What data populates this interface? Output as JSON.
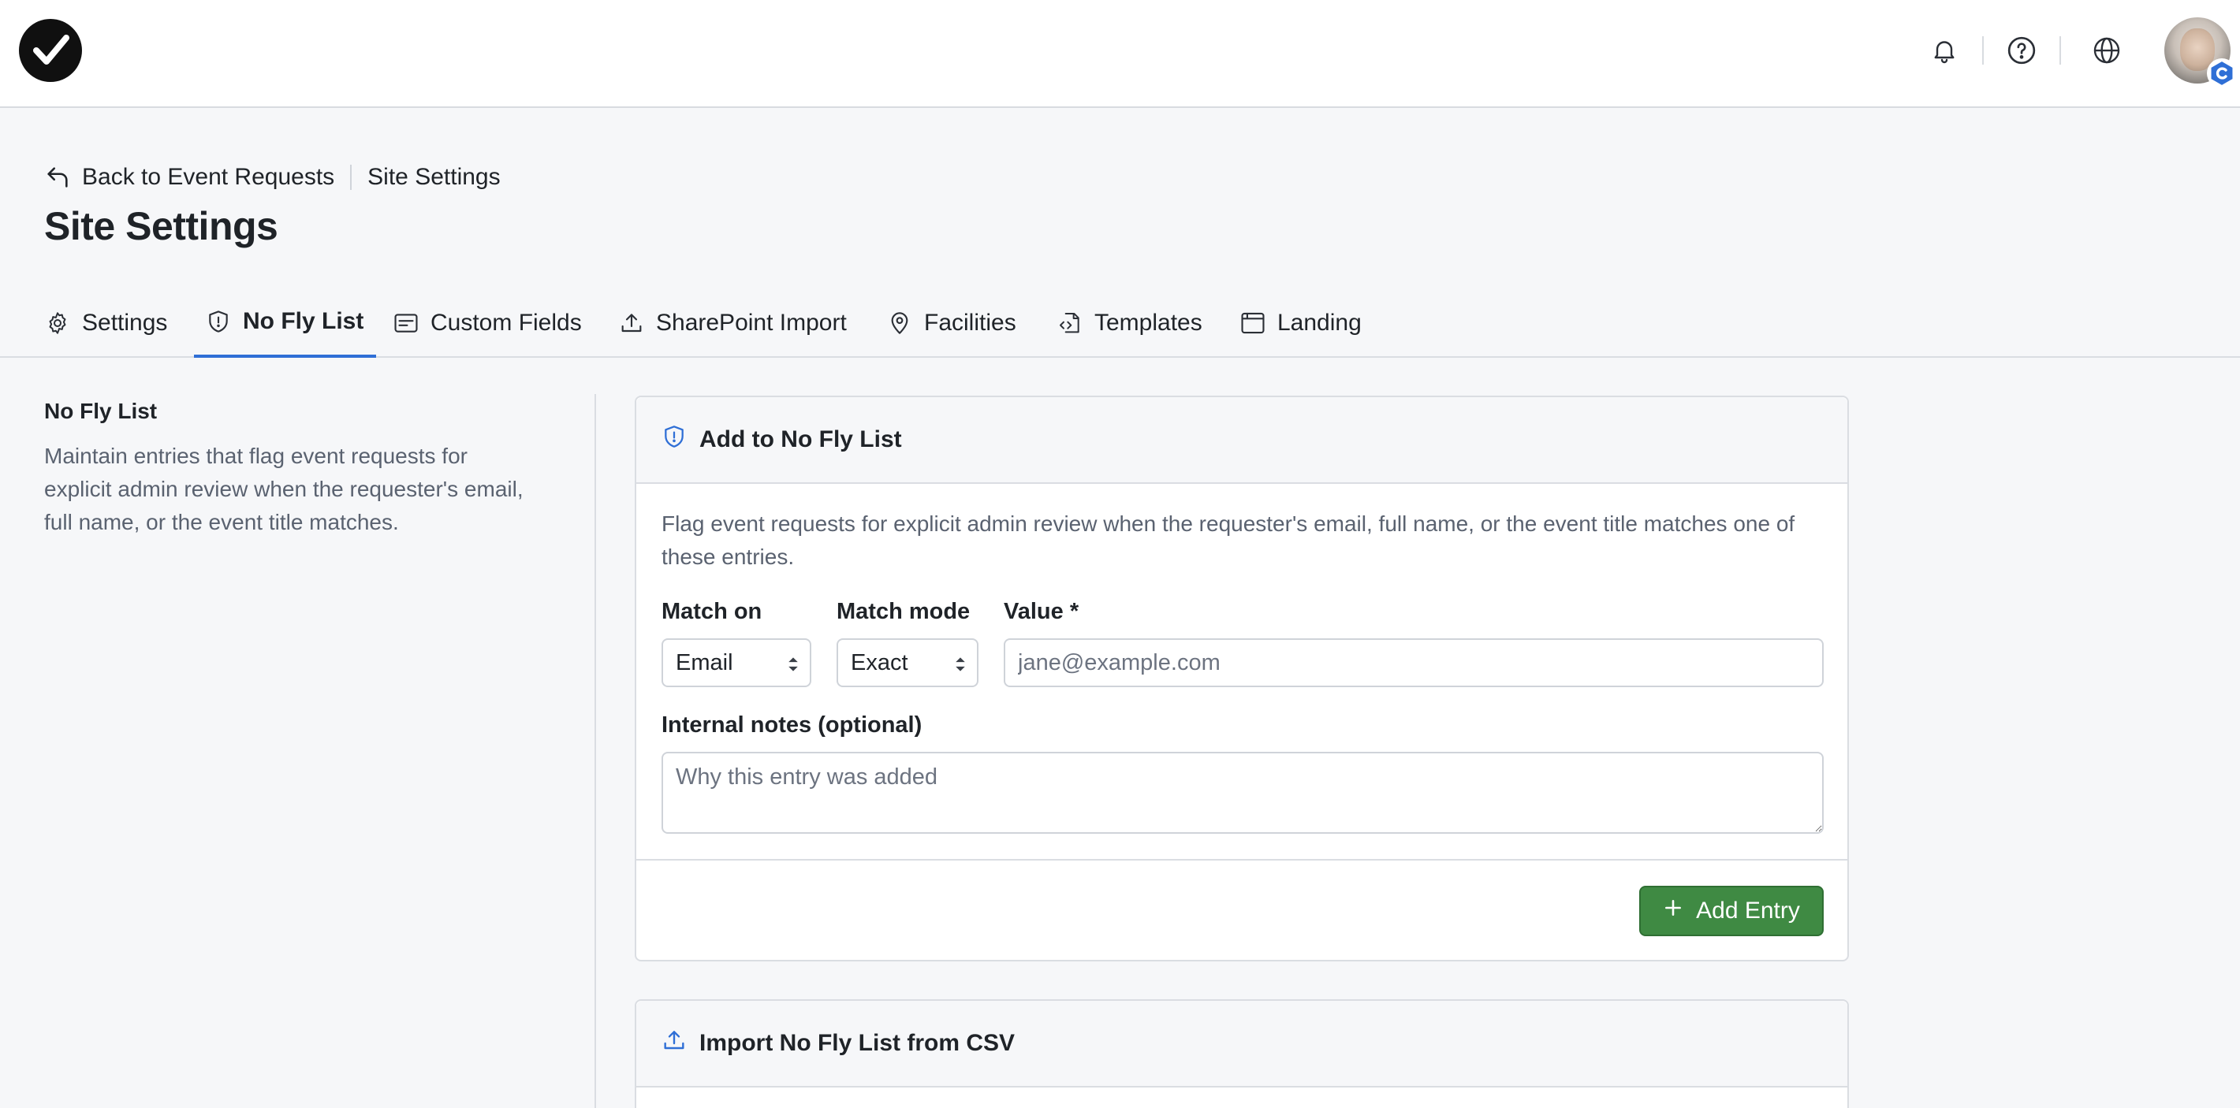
{
  "header": {
    "icons": [
      "bell-icon",
      "help-icon",
      "globe-icon"
    ],
    "avatar_badge": "C"
  },
  "breadcrumb": {
    "back_label": "Back to Event Requests",
    "current": "Site Settings"
  },
  "page_title": "Site Settings",
  "tabs": [
    {
      "label": "Settings",
      "icon": "gear-icon",
      "active": false
    },
    {
      "label": "No Fly List",
      "icon": "shield-alert-icon",
      "active": true
    },
    {
      "label": "Custom Fields",
      "icon": "form-icon",
      "active": false
    },
    {
      "label": "SharePoint Import",
      "icon": "upload-icon",
      "active": false
    },
    {
      "label": "Facilities",
      "icon": "map-pin-icon",
      "active": false
    },
    {
      "label": "Templates",
      "icon": "file-code-icon",
      "active": false
    },
    {
      "label": "Landing",
      "icon": "browser-icon",
      "active": false
    }
  ],
  "section": {
    "title": "No Fly List",
    "description": "Maintain entries that flag event requests for explicit admin review when the requester's email, full name, or the event title matches."
  },
  "add_card": {
    "title": "Add to No Fly List",
    "intro": "Flag event requests for explicit admin review when the requester's email, full name, or the event title matches one of these entries.",
    "match_on_label": "Match on",
    "match_on_value": "Email",
    "match_mode_label": "Match mode",
    "match_mode_value": "Exact",
    "value_label": "Value *",
    "value_placeholder": "jane@example.com",
    "notes_label": "Internal notes (optional)",
    "notes_placeholder": "Why this entry was added",
    "add_button": "Add Entry"
  },
  "import_card": {
    "title": "Import No Fly List from CSV"
  },
  "colors": {
    "accent": "#2f6fd6",
    "primary_button": "#3f8a43"
  }
}
